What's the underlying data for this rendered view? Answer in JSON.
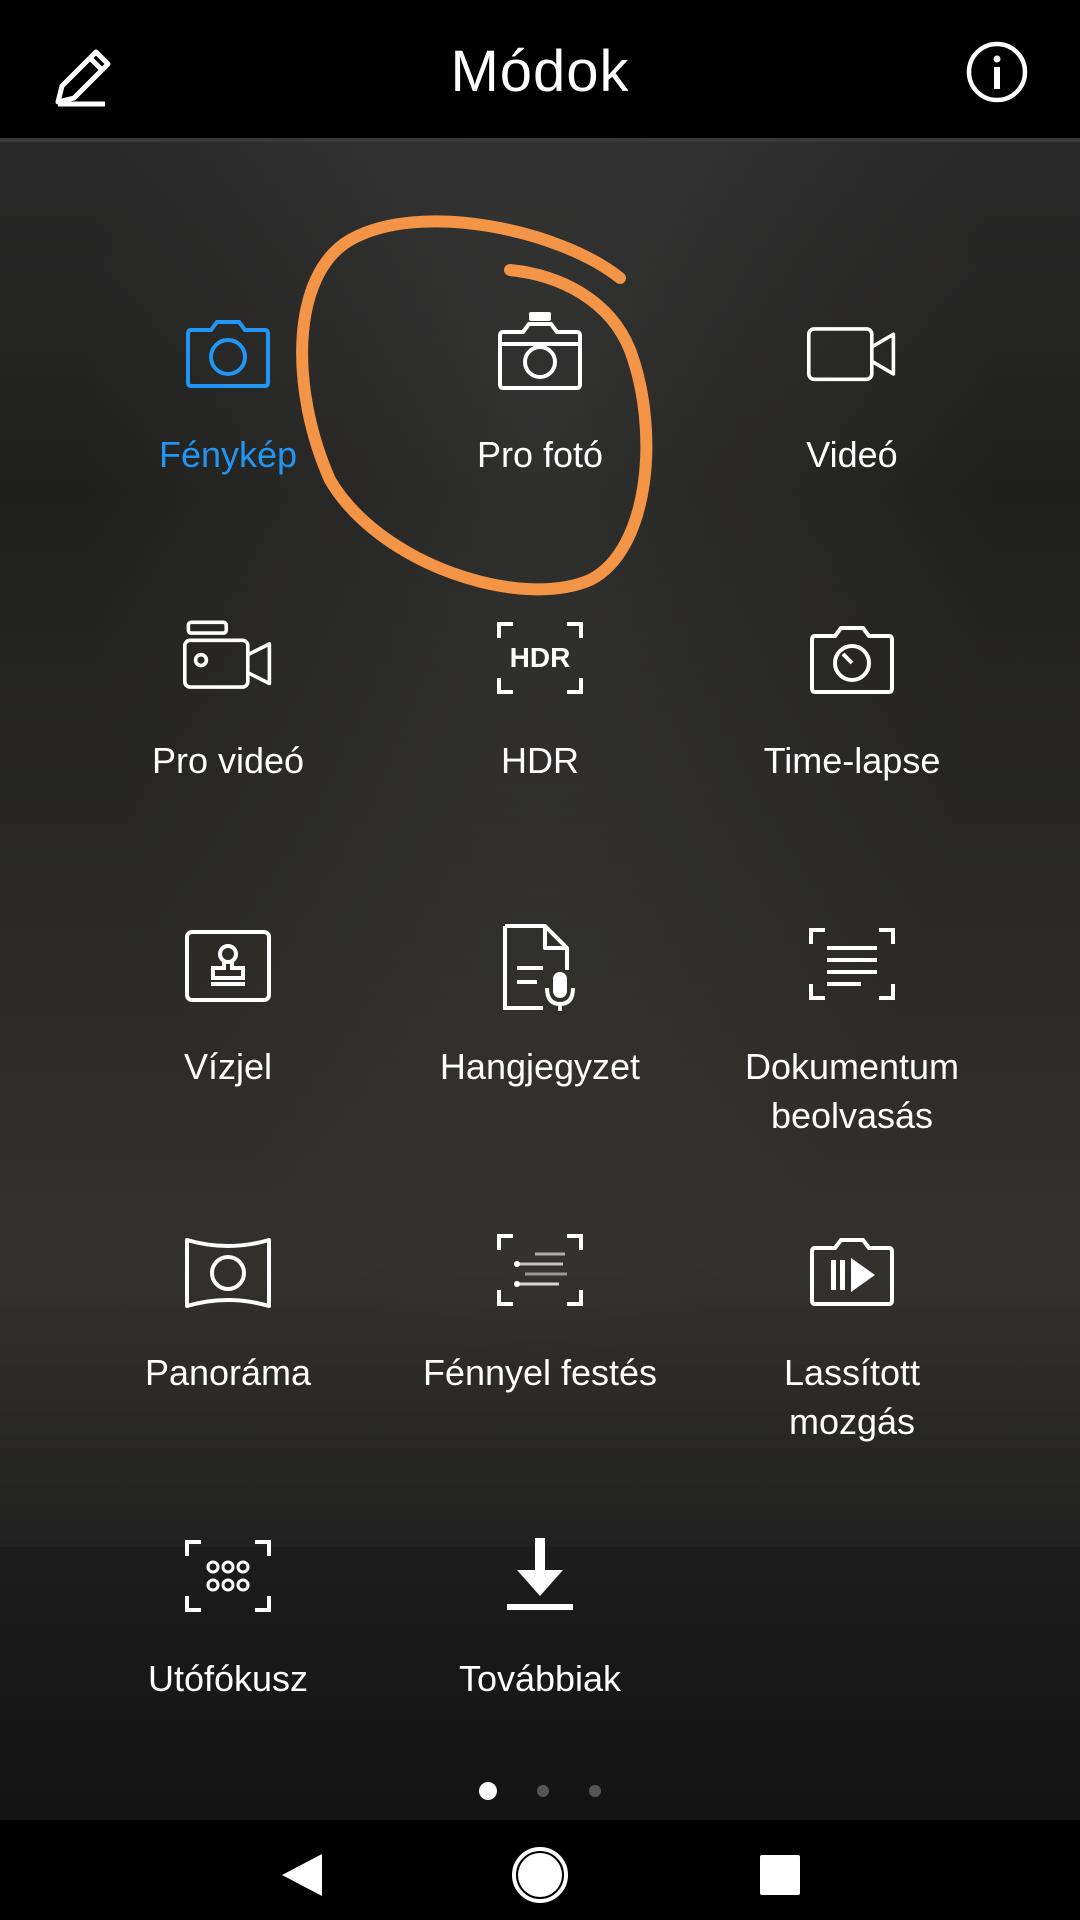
{
  "header": {
    "title": "Módok",
    "edit_icon": "pencil-icon",
    "info_icon": "info-icon"
  },
  "modes": [
    {
      "label": "Fénykép",
      "icon": "camera-icon",
      "active": true
    },
    {
      "label": "Pro fotó",
      "icon": "pro-camera-icon",
      "active": false
    },
    {
      "label": "Videó",
      "icon": "video-camera-icon",
      "active": false
    },
    {
      "label": "Pro videó",
      "icon": "pro-video-icon",
      "active": false
    },
    {
      "label": "HDR",
      "icon": "hdr-icon",
      "active": false
    },
    {
      "label": "Time-lapse",
      "icon": "timelapse-icon",
      "active": false
    },
    {
      "label": "Vízjel",
      "icon": "watermark-icon",
      "active": false
    },
    {
      "label": "Hangjegyzet",
      "icon": "audio-note-icon",
      "active": false
    },
    {
      "label": "Dokumentum\nbeolvasás",
      "icon": "document-scan-icon",
      "active": false
    },
    {
      "label": "Panoráma",
      "icon": "panorama-icon",
      "active": false
    },
    {
      "label": "Fénnyel festés",
      "icon": "light-painting-icon",
      "active": false
    },
    {
      "label": "Lassított\nmozgás",
      "icon": "slow-motion-icon",
      "active": false
    },
    {
      "label": "Utófókusz",
      "icon": "aperture-icon",
      "active": false
    },
    {
      "label": "Továbbiak",
      "icon": "download-icon",
      "active": false
    }
  ],
  "page_indicator": {
    "pages": 3,
    "current": 1
  },
  "navbar": {
    "back_icon": "back-icon",
    "home_icon": "home-icon",
    "recents_icon": "recents-icon"
  },
  "colors": {
    "accent": "#2196f3",
    "annotation": "#f39447",
    "text": "#ffffff"
  }
}
